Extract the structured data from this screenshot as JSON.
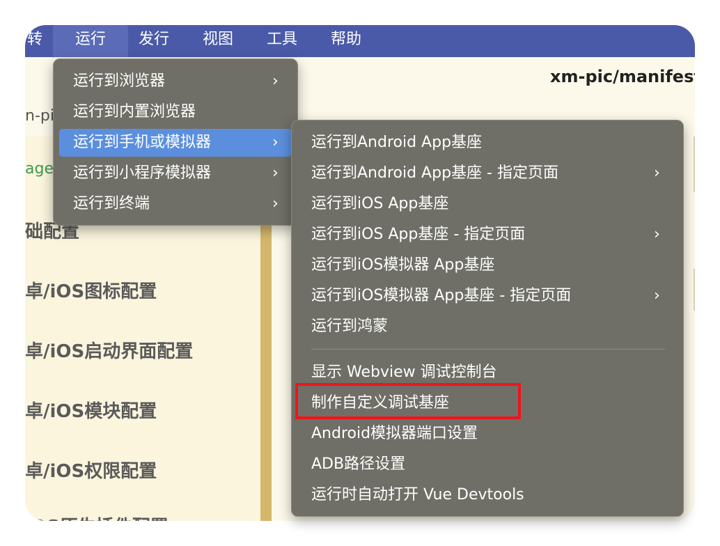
{
  "menubar": {
    "items": [
      {
        "label": "转"
      },
      {
        "label": "运行"
      },
      {
        "label": "发行"
      },
      {
        "label": "视图"
      },
      {
        "label": "工具"
      },
      {
        "label": "帮助"
      }
    ]
  },
  "editor": {
    "file_title": "xm-pic/manifest",
    "tab_fragment": "n-pi",
    "pages_fragment": "ages"
  },
  "sidebar": {
    "items": [
      {
        "label": "础配置"
      },
      {
        "label": "卓/iOS图标配置"
      },
      {
        "label": "卓/iOS启动界面配置"
      },
      {
        "label": "卓/iOS模块配置"
      },
      {
        "label": "卓/iOS权限配置"
      },
      {
        "label": "iOS原生插件配置"
      }
    ]
  },
  "run_menu": {
    "items": [
      {
        "label": "运行到浏览器",
        "has_submenu": true
      },
      {
        "label": "运行到内置浏览器",
        "has_submenu": false
      },
      {
        "label": "运行到手机或模拟器",
        "has_submenu": true,
        "highlighted": true
      },
      {
        "label": "运行到小程序模拟器",
        "has_submenu": true
      },
      {
        "label": "运行到终端",
        "has_submenu": true
      }
    ]
  },
  "device_submenu": {
    "items": [
      {
        "label": "运行到Android App基座",
        "has_submenu": false
      },
      {
        "label": "运行到Android App基座 - 指定页面",
        "has_submenu": true
      },
      {
        "label": "运行到iOS App基座",
        "has_submenu": false
      },
      {
        "label": "运行到iOS App基座 - 指定页面",
        "has_submenu": true
      },
      {
        "label": "运行到iOS模拟器 App基座",
        "has_submenu": false
      },
      {
        "label": "运行到iOS模拟器 App基座 - 指定页面",
        "has_submenu": true
      },
      {
        "label": "运行到鸿蒙",
        "has_submenu": false
      },
      {
        "label": "显示 Webview 调试控制台",
        "has_submenu": false
      },
      {
        "label": "制作自定义调试基座",
        "has_submenu": false,
        "annotated": true
      },
      {
        "label": "Android模拟器端口设置",
        "has_submenu": false
      },
      {
        "label": "ADB路径设置",
        "has_submenu": false
      },
      {
        "label": "运行时自动打开 Vue Devtools",
        "has_submenu": false
      }
    ]
  },
  "icons": {
    "chevron": "chevron-right-icon"
  },
  "colors": {
    "menubar": "#4a5aa8",
    "menu_bg": "#6f6f67",
    "highlight": "#5b8fde",
    "annotation": "#f2131b",
    "sidebar_strip": "#d4b76c"
  }
}
